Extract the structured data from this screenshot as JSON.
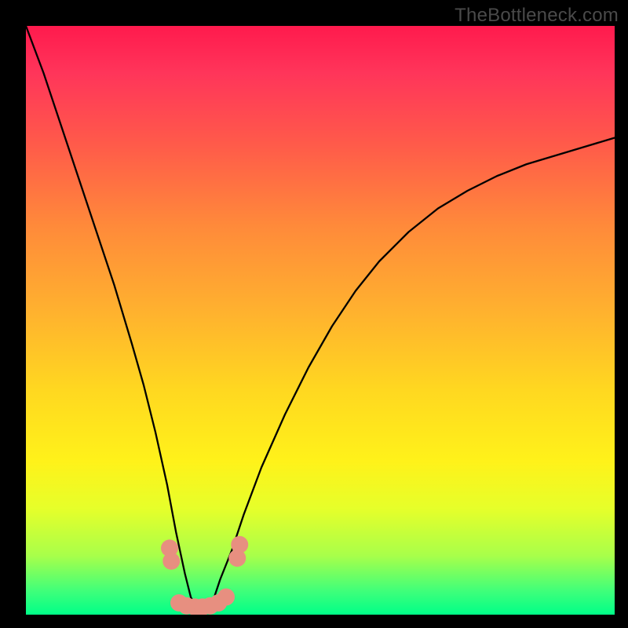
{
  "watermark": "TheBottleneck.com",
  "chart_data": {
    "type": "line",
    "title": "",
    "xlabel": "",
    "ylabel": "",
    "xlim": [
      0,
      100
    ],
    "ylim": [
      0,
      100
    ],
    "background_gradient": {
      "top_color": "#ff1a4d",
      "mid1_color": "#ff8a3a",
      "mid2_color": "#ffe020",
      "bottom_color": "#00ff88"
    },
    "series": [
      {
        "name": "bottleneck-curve",
        "color": "#000000",
        "x": [
          0,
          3,
          6,
          9,
          12,
          15,
          18,
          20,
          22,
          24,
          25.5,
          27,
          28,
          29,
          30,
          31,
          32,
          33,
          35,
          37,
          40,
          44,
          48,
          52,
          56,
          60,
          65,
          70,
          75,
          80,
          85,
          90,
          95,
          100
        ],
        "y": [
          100,
          92,
          83,
          74,
          65,
          56,
          46,
          39,
          31,
          22,
          14,
          7,
          3,
          1,
          0.5,
          1,
          3,
          6,
          11,
          17,
          25,
          34,
          42,
          49,
          55,
          60,
          65,
          69,
          72,
          74.5,
          76.5,
          78,
          79.5,
          81
        ]
      }
    ],
    "markers": [
      {
        "name": "valley-dots",
        "shape": "circle",
        "radius_px": 11,
        "color": "#e78f80",
        "points": [
          {
            "x": 24.4,
            "y": 11.3
          },
          {
            "x": 24.7,
            "y": 9.1
          },
          {
            "x": 26.0,
            "y": 2.0
          },
          {
            "x": 27.3,
            "y": 1.5
          },
          {
            "x": 28.7,
            "y": 1.3
          },
          {
            "x": 30.0,
            "y": 1.3
          },
          {
            "x": 31.3,
            "y": 1.5
          },
          {
            "x": 32.7,
            "y": 2.0
          },
          {
            "x": 34.0,
            "y": 3.0
          },
          {
            "x": 35.9,
            "y": 9.6
          },
          {
            "x": 36.3,
            "y": 11.9
          }
        ]
      }
    ]
  }
}
